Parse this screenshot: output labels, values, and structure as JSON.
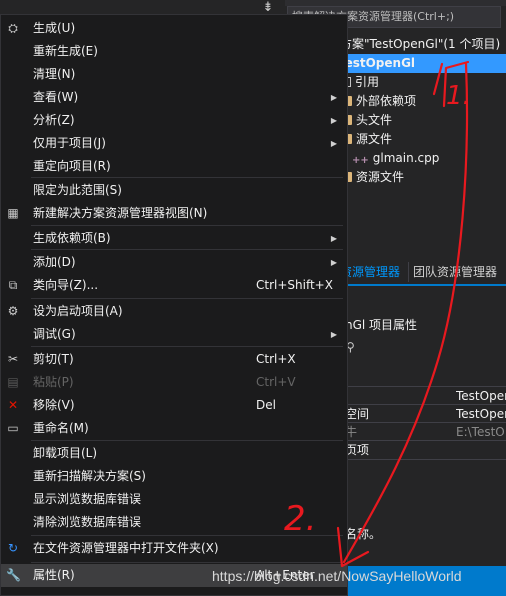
{
  "explorer": {
    "search_placeholder": "搜索解决方案资源管理器(Ctrl+;)",
    "solution_label": "方案\"TestOpenGl\"(1 个项目)",
    "project": "TestOpenGl",
    "nodes": [
      "引用",
      "外部依赖项",
      "头文件",
      "源文件",
      "glmain.cpp",
      "资源文件"
    ],
    "tabs": [
      "资源管理器",
      "团队资源管理器"
    ],
    "props_title": "nGl  项目属性",
    "props_rows": [
      {
        "k": "",
        "v": "TestOpen"
      },
      {
        "k": "空间",
        "v": "TestOpen"
      },
      {
        "k": "牛",
        "v": "E:\\TestO"
      },
      {
        "k": "页项",
        "v": ""
      }
    ],
    "desc_fragment": "名称。"
  },
  "menu": {
    "items": [
      {
        "label": "生成(U)",
        "shortcut": "",
        "icon": "build-icon",
        "submenu": false
      },
      {
        "label": "重新生成(E)",
        "shortcut": "",
        "icon": "",
        "submenu": false
      },
      {
        "label": "清理(N)",
        "shortcut": "",
        "icon": "",
        "submenu": false
      },
      {
        "label": "查看(W)",
        "shortcut": "",
        "icon": "",
        "submenu": true
      },
      {
        "label": "分析(Z)",
        "shortcut": "",
        "icon": "",
        "submenu": true
      },
      {
        "label": "仅用于项目(J)",
        "shortcut": "",
        "icon": "",
        "submenu": true
      },
      {
        "label": "重定向项目(R)",
        "shortcut": "",
        "icon": "",
        "submenu": false
      },
      {
        "label": "限定为此范围(S)",
        "shortcut": "",
        "icon": "",
        "submenu": false
      },
      {
        "label": "新建解决方案资源管理器视图(N)",
        "shortcut": "",
        "icon": "new-view-icon",
        "submenu": false
      },
      {
        "label": "生成依赖项(B)",
        "shortcut": "",
        "icon": "",
        "submenu": true
      },
      {
        "label": "添加(D)",
        "shortcut": "",
        "icon": "",
        "submenu": true
      },
      {
        "label": "类向导(Z)...",
        "shortcut": "Ctrl+Shift+X",
        "icon": "class-wizard-icon",
        "submenu": false
      },
      {
        "label": "设为启动项目(A)",
        "shortcut": "",
        "icon": "gear-icon",
        "submenu": false
      },
      {
        "label": "调试(G)",
        "shortcut": "",
        "icon": "",
        "submenu": true
      },
      {
        "label": "剪切(T)",
        "shortcut": "Ctrl+X",
        "icon": "scissors-icon",
        "submenu": false
      },
      {
        "label": "粘贴(P)",
        "shortcut": "Ctrl+V",
        "icon": "paste-icon",
        "submenu": false,
        "disabled": true
      },
      {
        "label": "移除(V)",
        "shortcut": "Del",
        "icon": "remove-icon",
        "submenu": false
      },
      {
        "label": "重命名(M)",
        "shortcut": "",
        "icon": "rename-icon",
        "submenu": false
      },
      {
        "label": "卸载项目(L)",
        "shortcut": "",
        "icon": "",
        "submenu": false
      },
      {
        "label": "重新扫描解决方案(S)",
        "shortcut": "",
        "icon": "",
        "submenu": false
      },
      {
        "label": "显示浏览数据库错误",
        "shortcut": "",
        "icon": "",
        "submenu": false
      },
      {
        "label": "清除浏览数据库错误",
        "shortcut": "",
        "icon": "",
        "submenu": false
      },
      {
        "label": "在文件资源管理器中打开文件夹(X)",
        "shortcut": "",
        "icon": "open-folder-icon",
        "submenu": false
      },
      {
        "label": "属性(R)",
        "shortcut": "Alt+Enter",
        "icon": "wrench-icon",
        "submenu": false,
        "hover": true
      }
    ]
  },
  "annotations": {
    "step1": "1.",
    "step2": "2.",
    "color": "#e8191f"
  },
  "watermark": "https://blog.csdn.net/NowSayHelloWorld"
}
